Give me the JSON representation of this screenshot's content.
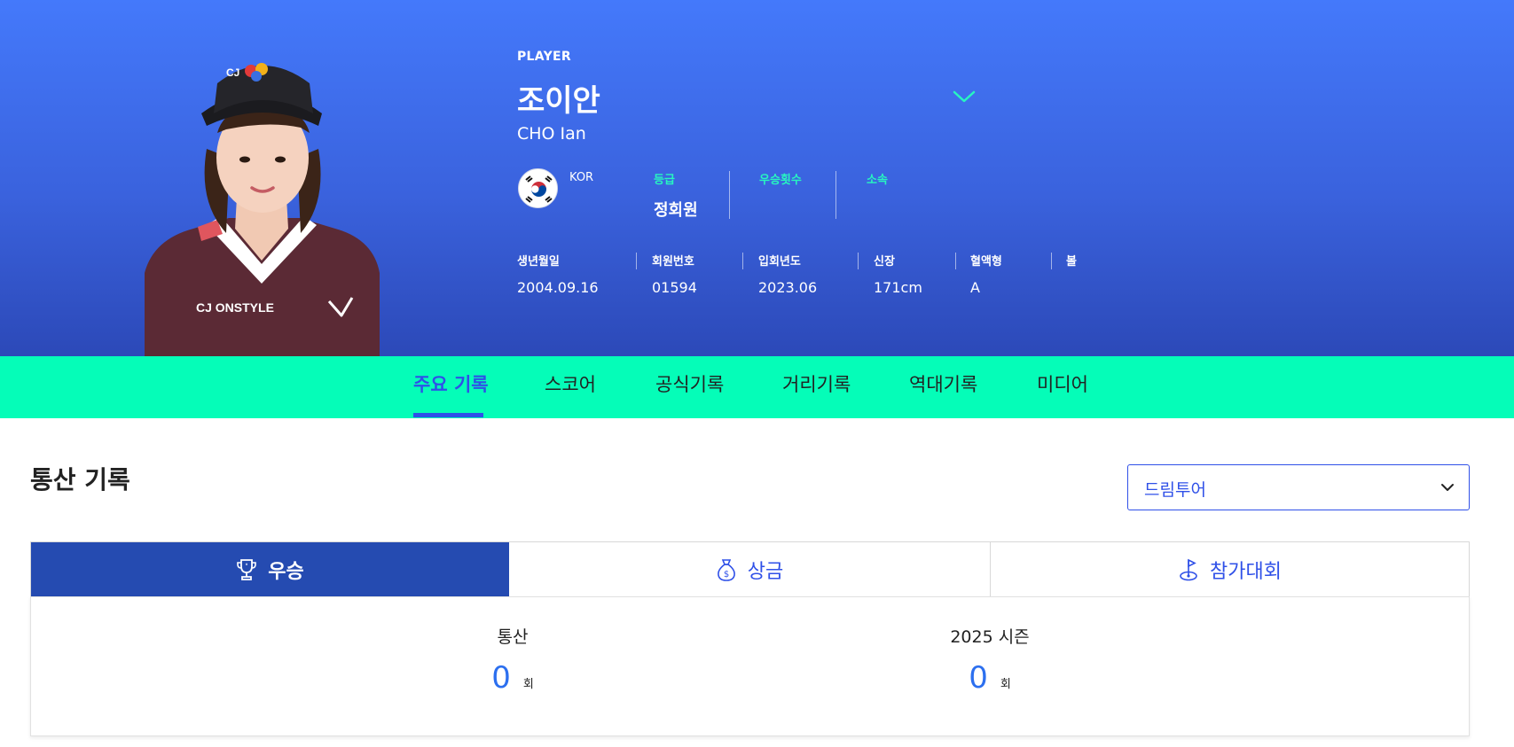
{
  "player": {
    "eyebrow": "PLAYER",
    "name_ko": "조이안",
    "name_en": "CHO Ian",
    "nationality": "KOR",
    "stats": [
      {
        "label": "등급",
        "value": "정회원"
      },
      {
        "label": "우승횟수",
        "value": ""
      },
      {
        "label": "소속",
        "value": ""
      }
    ],
    "meta": [
      {
        "label": "생년월일",
        "value": "2004.09.16"
      },
      {
        "label": "회원번호",
        "value": "01594"
      },
      {
        "label": "입회년도",
        "value": "2023.06"
      },
      {
        "label": "신장",
        "value": "171cm"
      },
      {
        "label": "혈액형",
        "value": "A"
      },
      {
        "label": "볼",
        "value": ""
      }
    ],
    "photo_text": {
      "cap_logo": "CJ",
      "shirt_logo": "CJ ONSTYLE"
    }
  },
  "nav": {
    "tabs": [
      "주요 기록",
      "스코어",
      "공식기록",
      "거리기록",
      "역대기록",
      "미디어"
    ],
    "active_index": 0
  },
  "content": {
    "section_title": "통산 기록",
    "tour_select": {
      "value": "드림투어"
    },
    "record_tabs": [
      {
        "label": "우승",
        "icon": "trophy-icon"
      },
      {
        "label": "상금",
        "icon": "money-bag-icon"
      },
      {
        "label": "참가대회",
        "icon": "golf-flag-icon"
      }
    ],
    "summary": [
      {
        "label": "통산",
        "value": "0",
        "unit": "회"
      },
      {
        "label": "2025 시즌",
        "value": "0",
        "unit": "회"
      }
    ]
  },
  "colors": {
    "hero_gradient_top": "#4479fb",
    "hero_gradient_bottom": "#2c49b8",
    "nav_bg": "#05fdb8",
    "accent": "#2f50e8",
    "label_mint": "#27f6c0",
    "active_tab_bg": "#254bb1"
  }
}
